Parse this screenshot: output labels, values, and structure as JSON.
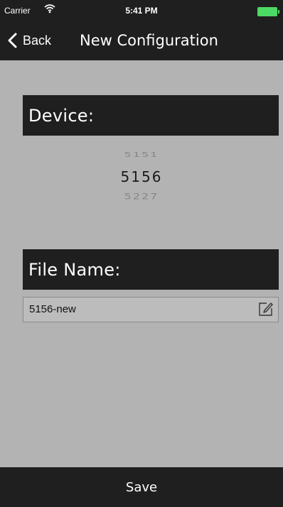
{
  "status_bar": {
    "carrier": "Carrier",
    "time": "5:41 PM",
    "wifi_icon": "wifi-icon",
    "battery_icon": "battery-icon"
  },
  "nav": {
    "back_label": "Back",
    "title": "New Configuration"
  },
  "device": {
    "header": "Device:",
    "picker": {
      "previous": "5151",
      "selected": "5156",
      "next": "5227"
    }
  },
  "file": {
    "header": "File Name:",
    "value": "5156-new",
    "edit_icon": "edit-icon"
  },
  "footer": {
    "save_label": "Save"
  },
  "colors": {
    "bar": "#1f1f1f",
    "background": "#b3b3b3",
    "battery": "#4cd964"
  }
}
